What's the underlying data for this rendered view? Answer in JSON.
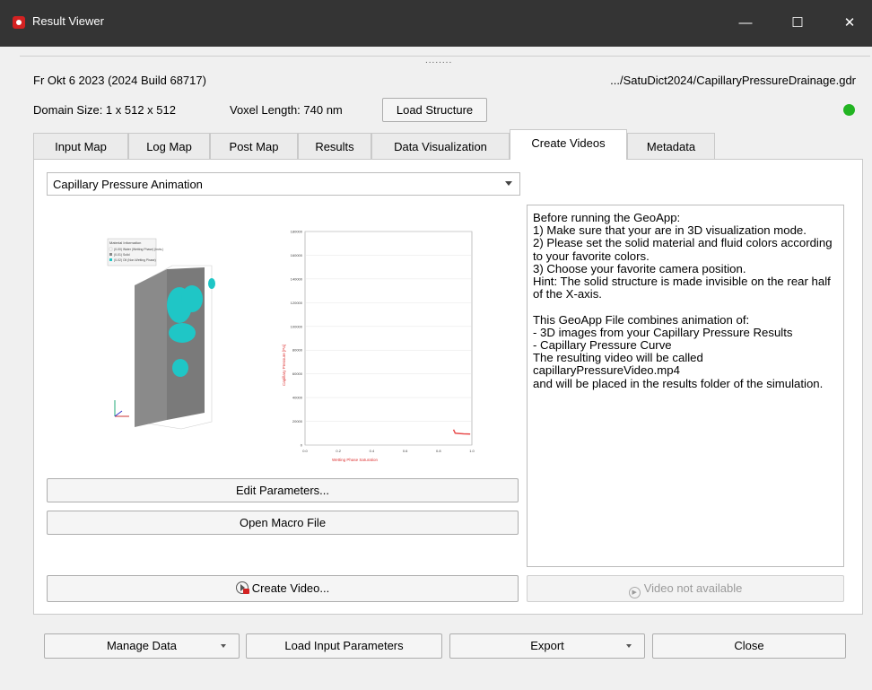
{
  "window": {
    "title": "Result Viewer",
    "min_label": "—",
    "max_label": "☐",
    "close_label": "✕"
  },
  "splitter_grip": "........",
  "header": {
    "date_build": "Fr Okt 6 2023 (2024 Build 68717)",
    "file_path": ".../SatuDict2024/CapillaryPressureDrainage.gdr",
    "domain_size": "Domain Size: 1 x 512 x 512",
    "voxel_length": "Voxel Length: 740 nm",
    "load_structure_label": "Load Structure",
    "status_color": "#22b422"
  },
  "tabs": [
    {
      "label": "Input Map"
    },
    {
      "label": "Log Map"
    },
    {
      "label": "Post Map"
    },
    {
      "label": "Results"
    },
    {
      "label": "Data Visualization"
    },
    {
      "label": "Create Videos"
    },
    {
      "label": "Metadata"
    }
  ],
  "active_tab": "Create Videos",
  "create_videos": {
    "animation_select": "Capillary Pressure Animation",
    "edit_parameters_label": "Edit Parameters...",
    "open_macro_label": "Open Macro File",
    "create_video_label": "Create Video...",
    "video_status_label": "Video not available",
    "description": "Before running the GeoApp:\n1) Make sure that your are in 3D visualization mode.\n2) Please set the solid material and fluid colors according to your favorite colors.\n3) Choose your favorite camera position.\nHint: The solid structure is made invisible on the rear half of the X-axis.\n\nThis GeoApp File combines animation of:\n- 3D images from your Capillary Pressure Results\n- Capillary Pressure Curve\nThe resulting video will be called capillaryPressureVideo.mp4\nand will be placed in the results folder of the simulation."
  },
  "preview": {
    "legend_title": "Material Information",
    "legend_items": [
      "(0-00) Water (Wetting Phase) (Invis.)",
      "(0-01) Solid",
      "(0-02) Oil (Non-Wetting Phase)"
    ],
    "solid_color": "#8a8a8a",
    "fluid_color": "#1fc6c6",
    "chart_data": {
      "type": "line",
      "xlabel": "Wetting Phase Saturation",
      "ylabel": "Capillary Pressure [Pa]",
      "xticks": [
        "0.0",
        "0.2",
        "0.4",
        "0.6",
        "0.8",
        "1.0"
      ],
      "yticks": [
        "0",
        "20000",
        "40000",
        "60000",
        "80000",
        "100000",
        "120000",
        "140000",
        "160000",
        "180000"
      ],
      "xlim": [
        0,
        1
      ],
      "ylim": [
        0,
        180000
      ],
      "series": [
        {
          "values": [
            [
              0.89,
              13000
            ],
            [
              0.9,
              10000
            ],
            [
              0.95,
              9500
            ],
            [
              0.99,
              9300
            ]
          ],
          "color": "#e84b4b"
        }
      ]
    }
  },
  "bottom_bar": {
    "manage_data_label": "Manage Data",
    "load_input_label": "Load Input Parameters",
    "export_label": "Export",
    "close_label": "Close"
  }
}
